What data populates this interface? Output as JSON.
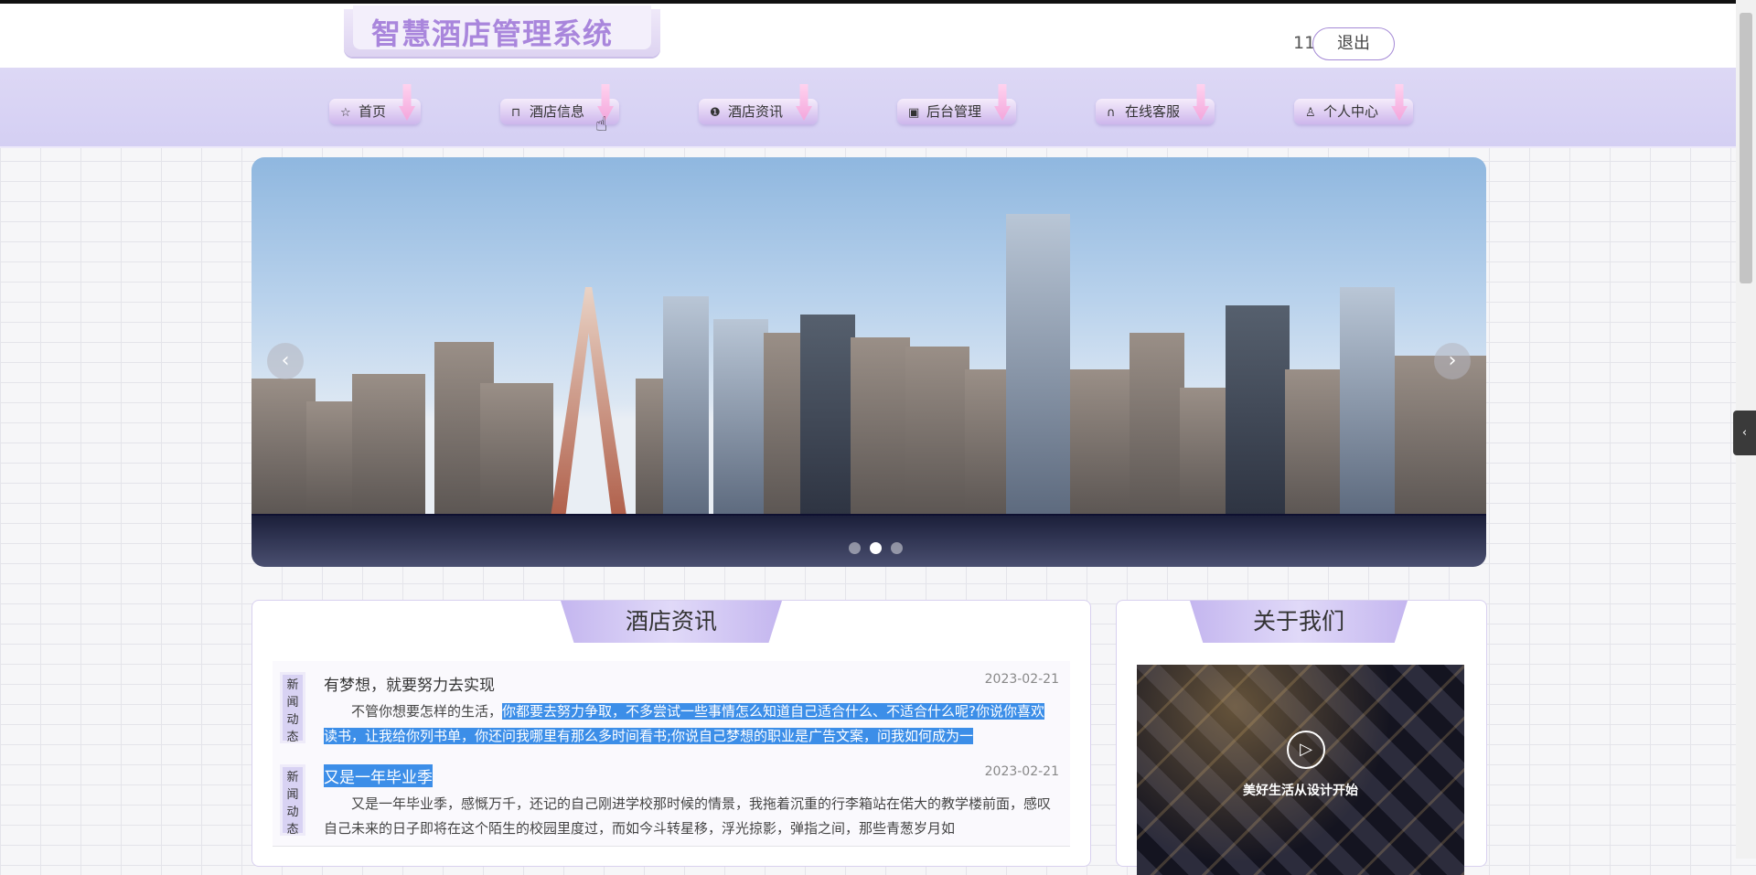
{
  "header": {
    "logo_text": "智慧酒店管理系统",
    "user_id": "11",
    "logout_label": "退出"
  },
  "nav": [
    {
      "label": "首页",
      "icon": "star-icon",
      "glyph": "☆"
    },
    {
      "label": "酒店信息",
      "icon": "bag-icon",
      "glyph": "⊓"
    },
    {
      "label": "酒店资讯",
      "icon": "info-icon",
      "glyph": "❶"
    },
    {
      "label": "后台管理",
      "icon": "box-icon",
      "glyph": "▣"
    },
    {
      "label": "在线客服",
      "icon": "headset-icon",
      "glyph": "∩"
    },
    {
      "label": "个人中心",
      "icon": "user-icon",
      "glyph": "♙"
    }
  ],
  "banner": {
    "prev_glyph": "‹",
    "next_glyph": "›",
    "slide_count": 3,
    "active_slide": 2
  },
  "news": {
    "title": "酒店资讯",
    "items": [
      {
        "tag": "新闻动态",
        "title": "有梦想，就要努力去实现",
        "date": "2023-02-21",
        "body_plain": "不管你想要怎样的生活，",
        "body_highlight": "你都要去努力争取，不多尝试一些事情怎么知道自己适合什么、不适合什么呢?你说你喜欢读书，让我给你列书单，你还问我哪里有那么多时间看书;你说自己梦想的职业是广告文案，问我如何成为一"
      },
      {
        "tag": "新闻动态",
        "title": "又是一年毕业季",
        "date": "2023-02-21",
        "body_plain": "又是一年毕业季，感慨万千，还记的自己刚进学校那时候的情景，我拖着沉重的行李箱站在偌大的教学楼前面，感叹自己未来的日子即将在这个陌生的校园里度过，而如今斗转星移，浮光掠影，弹指之间，那些青葱岁月如",
        "body_highlight": ""
      }
    ]
  },
  "about": {
    "title": "关于我们",
    "caption": "美好生活从设计开始",
    "play_glyph": "▷"
  },
  "side_tab_glyph": "‹"
}
